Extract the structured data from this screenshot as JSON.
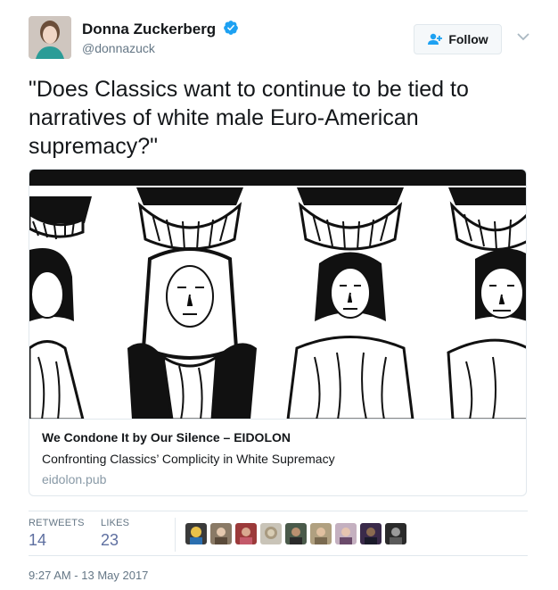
{
  "author": {
    "name": "Donna Zuckerberg",
    "handle": "@donnazuck",
    "verified": true
  },
  "follow_button": {
    "label": "Follow"
  },
  "tweet": {
    "text": "\"Does Classics want to continue to be tied to narratives of white male Euro-American supremacy?\""
  },
  "card": {
    "title": "We Condone It by Our Silence – EIDOLON",
    "description": "Confronting Classics’ Complicity in White Supremacy",
    "domain": "eidolon.pub"
  },
  "stats": {
    "retweets_label": "RETWEETS",
    "retweets_count": "14",
    "likes_label": "LIKES",
    "likes_count": "23"
  },
  "likers": [
    {
      "icon": "liker-avatar-1"
    },
    {
      "icon": "liker-avatar-2"
    },
    {
      "icon": "liker-avatar-3"
    },
    {
      "icon": "liker-avatar-4"
    },
    {
      "icon": "liker-avatar-5"
    },
    {
      "icon": "liker-avatar-6"
    },
    {
      "icon": "liker-avatar-7"
    },
    {
      "icon": "liker-avatar-8"
    },
    {
      "icon": "liker-avatar-9"
    }
  ],
  "timestamp": "9:27 AM - 13 May 2017",
  "colors": {
    "verified": "#1da1f2",
    "stat_value": "#5e6fa0",
    "muted": "#657786"
  }
}
